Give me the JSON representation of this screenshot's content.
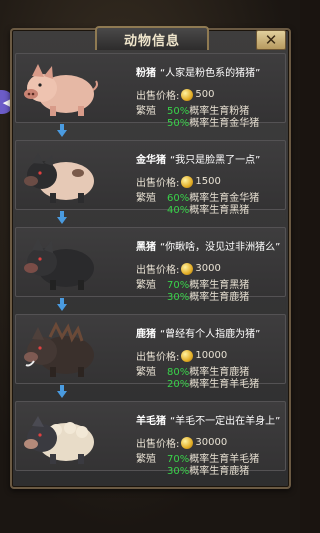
{
  "panel": {
    "title": "动物信息",
    "close_label": "✕"
  },
  "labels": {
    "price": "出售价格:",
    "breed": "繁殖"
  },
  "colors": {
    "percent": "#39d24a",
    "frame": "#6b5a43",
    "arrow": "#4a9be0"
  },
  "animals": [
    {
      "name": "粉猪",
      "quote": "“人家是粉色系的猪猪”",
      "price": "500",
      "breed": [
        {
          "pct": "50%",
          "text": "概率生育粉猪"
        },
        {
          "pct": "50%",
          "text": "概率生育金华猪"
        }
      ],
      "icon": "pink-pig-icon"
    },
    {
      "name": "金华猪",
      "quote": "“我只是脸黑了一点”",
      "price": "1500",
      "breed": [
        {
          "pct": "60%",
          "text": "概率生育金华猪"
        },
        {
          "pct": "40%",
          "text": "概率生育黑猪"
        }
      ],
      "icon": "jinhua-pig-icon"
    },
    {
      "name": "黑猪",
      "quote": "“你瞅啥，没见过非洲猪么”",
      "price": "3000",
      "breed": [
        {
          "pct": "70%",
          "text": "概率生育黑猪"
        },
        {
          "pct": "30%",
          "text": "概率生育鹿猪"
        }
      ],
      "icon": "black-pig-icon"
    },
    {
      "name": "鹿猪",
      "quote": "“曾经有个人指鹿为猪”",
      "price": "10000",
      "breed": [
        {
          "pct": "80%",
          "text": "概率生育鹿猪"
        },
        {
          "pct": "20%",
          "text": "概率生育羊毛猪"
        }
      ],
      "icon": "deer-pig-icon"
    },
    {
      "name": "羊毛猪",
      "quote": "“羊毛不一定出在羊身上”",
      "price": "30000",
      "breed": [
        {
          "pct": "70%",
          "text": "概率生育羊毛猪"
        },
        {
          "pct": "30%",
          "text": "概率生育鹿猪"
        }
      ],
      "icon": "wool-pig-icon"
    }
  ]
}
